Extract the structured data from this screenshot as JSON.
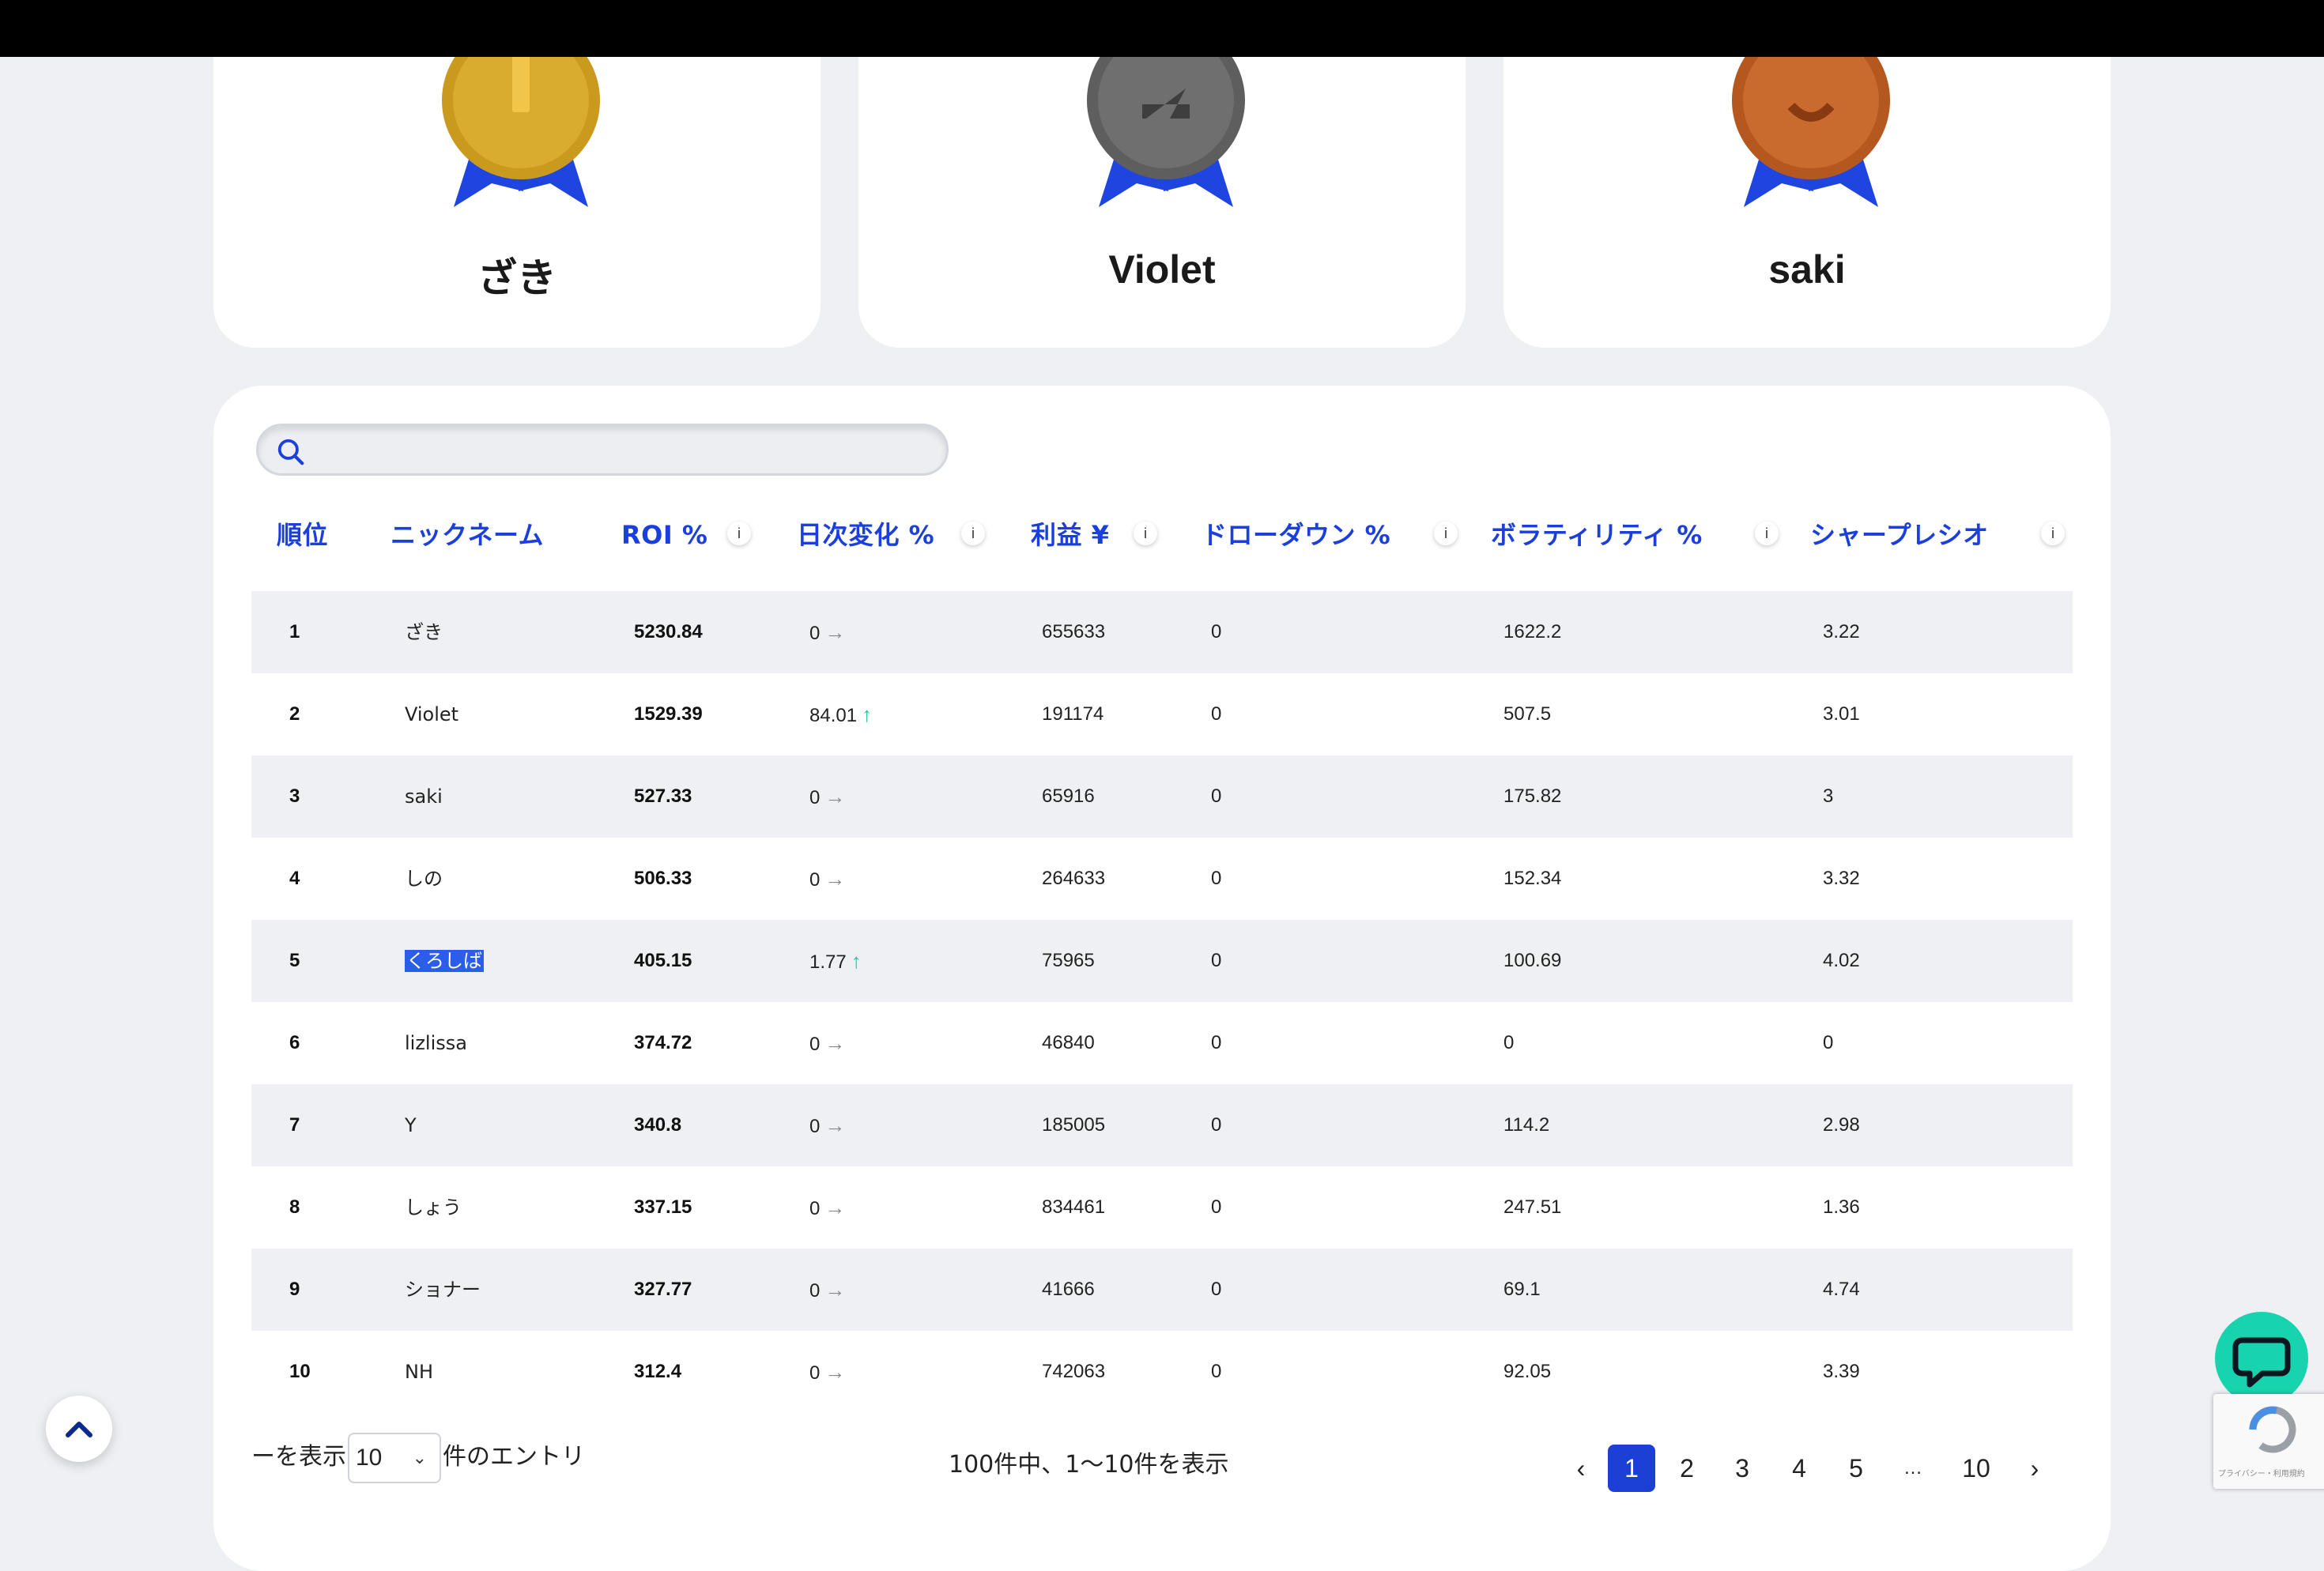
{
  "podium": [
    {
      "rank": "1",
      "name": "ざき",
      "medal": "gold-medal-icon",
      "color": "#c99a1e"
    },
    {
      "rank": "2",
      "name": "Violet",
      "medal": "silver-medal-icon",
      "color": "#6b6b6b"
    },
    {
      "rank": "3",
      "name": "saki",
      "medal": "bronze-medal-icon",
      "color": "#c2632b"
    }
  ],
  "search": {
    "placeholder": "",
    "value": "",
    "icon": "search-icon"
  },
  "table": {
    "headers": [
      "順位",
      "ニックネーム",
      "ROI %",
      "日次変化 %",
      "利益 ¥",
      "ドローダウン %",
      "ボラティリティ %",
      "シャープレシオ"
    ],
    "info_icon_label": "i",
    "rows": [
      {
        "rank": "1",
        "nickname": "ざき",
        "roi": "5230.84",
        "daily": "0",
        "trend": "flat",
        "profit": "655633",
        "drawdown": "0",
        "volatility": "1622.2",
        "sharpe": "3.22"
      },
      {
        "rank": "2",
        "nickname": "Violet",
        "roi": "1529.39",
        "daily": "84.01",
        "trend": "up",
        "profit": "191174",
        "drawdown": "0",
        "volatility": "507.5",
        "sharpe": "3.01"
      },
      {
        "rank": "3",
        "nickname": "saki",
        "roi": "527.33",
        "daily": "0",
        "trend": "flat",
        "profit": "65916",
        "drawdown": "0",
        "volatility": "175.82",
        "sharpe": "3"
      },
      {
        "rank": "4",
        "nickname": "しの",
        "roi": "506.33",
        "daily": "0",
        "trend": "flat",
        "profit": "264633",
        "drawdown": "0",
        "volatility": "152.34",
        "sharpe": "3.32"
      },
      {
        "rank": "5",
        "nickname": "くろしば",
        "roi": "405.15",
        "daily": "1.77",
        "trend": "up",
        "profit": "75965",
        "drawdown": "0",
        "volatility": "100.69",
        "sharpe": "4.02",
        "selected": true
      },
      {
        "rank": "6",
        "nickname": "lizlissa",
        "roi": "374.72",
        "daily": "0",
        "trend": "flat",
        "profit": "46840",
        "drawdown": "0",
        "volatility": "0",
        "sharpe": "0"
      },
      {
        "rank": "7",
        "nickname": "Y",
        "roi": "340.8",
        "daily": "0",
        "trend": "flat",
        "profit": "185005",
        "drawdown": "0",
        "volatility": "114.2",
        "sharpe": "2.98"
      },
      {
        "rank": "8",
        "nickname": "しょう",
        "roi": "337.15",
        "daily": "0",
        "trend": "flat",
        "profit": "834461",
        "drawdown": "0",
        "volatility": "247.51",
        "sharpe": "1.36"
      },
      {
        "rank": "9",
        "nickname": "ショナー",
        "roi": "327.77",
        "daily": "0",
        "trend": "flat",
        "profit": "41666",
        "drawdown": "0",
        "volatility": "69.1",
        "sharpe": "4.74"
      },
      {
        "rank": "10",
        "nickname": "NH",
        "roi": "312.4",
        "daily": "0",
        "trend": "flat",
        "profit": "742063",
        "drawdown": "0",
        "volatility": "92.05",
        "sharpe": "3.39"
      }
    ]
  },
  "footer": {
    "show_prefix": "ーを表示",
    "page_size": "10",
    "show_suffix": "件のエントリ",
    "info": "100件中、1〜10件を表示"
  },
  "pagination": {
    "prev_icon": "chevron-left-icon",
    "pages": [
      "1",
      "2",
      "3",
      "4",
      "5",
      "…",
      "10"
    ],
    "active": "1",
    "next_icon": "chevron-right-icon"
  },
  "colors": {
    "accent": "#1b3fdc",
    "up": "#19c9a0",
    "chat": "#18d4ae",
    "stripe": "#eef0f4"
  },
  "widgets": {
    "scroll_top_icon": "chevron-up-icon",
    "chat_icon": "chat-bubble-icon",
    "recaptcha_text": "プライバシー・利用規約"
  }
}
